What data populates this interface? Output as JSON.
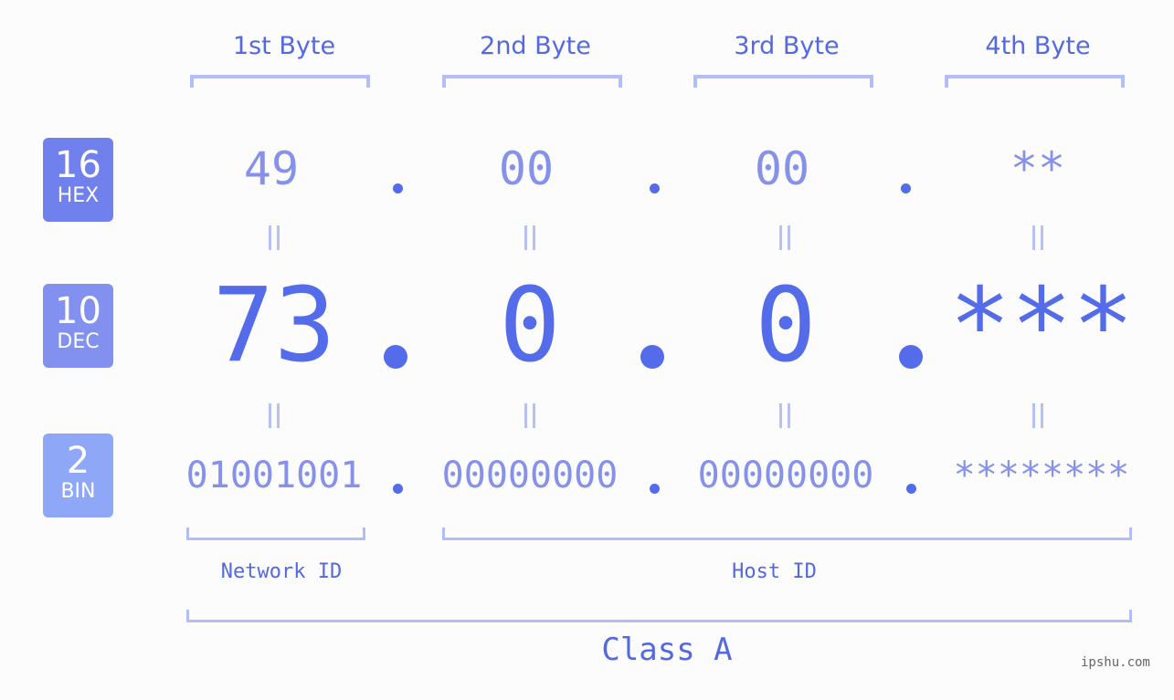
{
  "byte_headers": [
    "1st Byte",
    "2nd Byte",
    "3rd Byte",
    "4th Byte"
  ],
  "badges": {
    "hex": {
      "number": "16",
      "label": "HEX",
      "color": "#7080ec"
    },
    "dec": {
      "number": "10",
      "label": "DEC",
      "color": "#8291f0"
    },
    "bin": {
      "number": "2",
      "label": "BIN",
      "color": "#8ea7f7"
    }
  },
  "hex_values": [
    "49",
    "00",
    "00",
    "**"
  ],
  "dec_values": [
    "73",
    "0",
    "0",
    "***"
  ],
  "bin_values": [
    "01001001",
    "00000000",
    "00000000",
    "********"
  ],
  "separator": ".",
  "equals_symbol": "=",
  "id_labels": {
    "network": "Network ID",
    "host": "Host ID"
  },
  "class_label": "Class A",
  "watermark": "ipshu.com",
  "colors": {
    "primary": "#546ce9",
    "light": "#8591eb",
    "bracket": "#b3bdf7",
    "background": "#fbfcfb"
  }
}
